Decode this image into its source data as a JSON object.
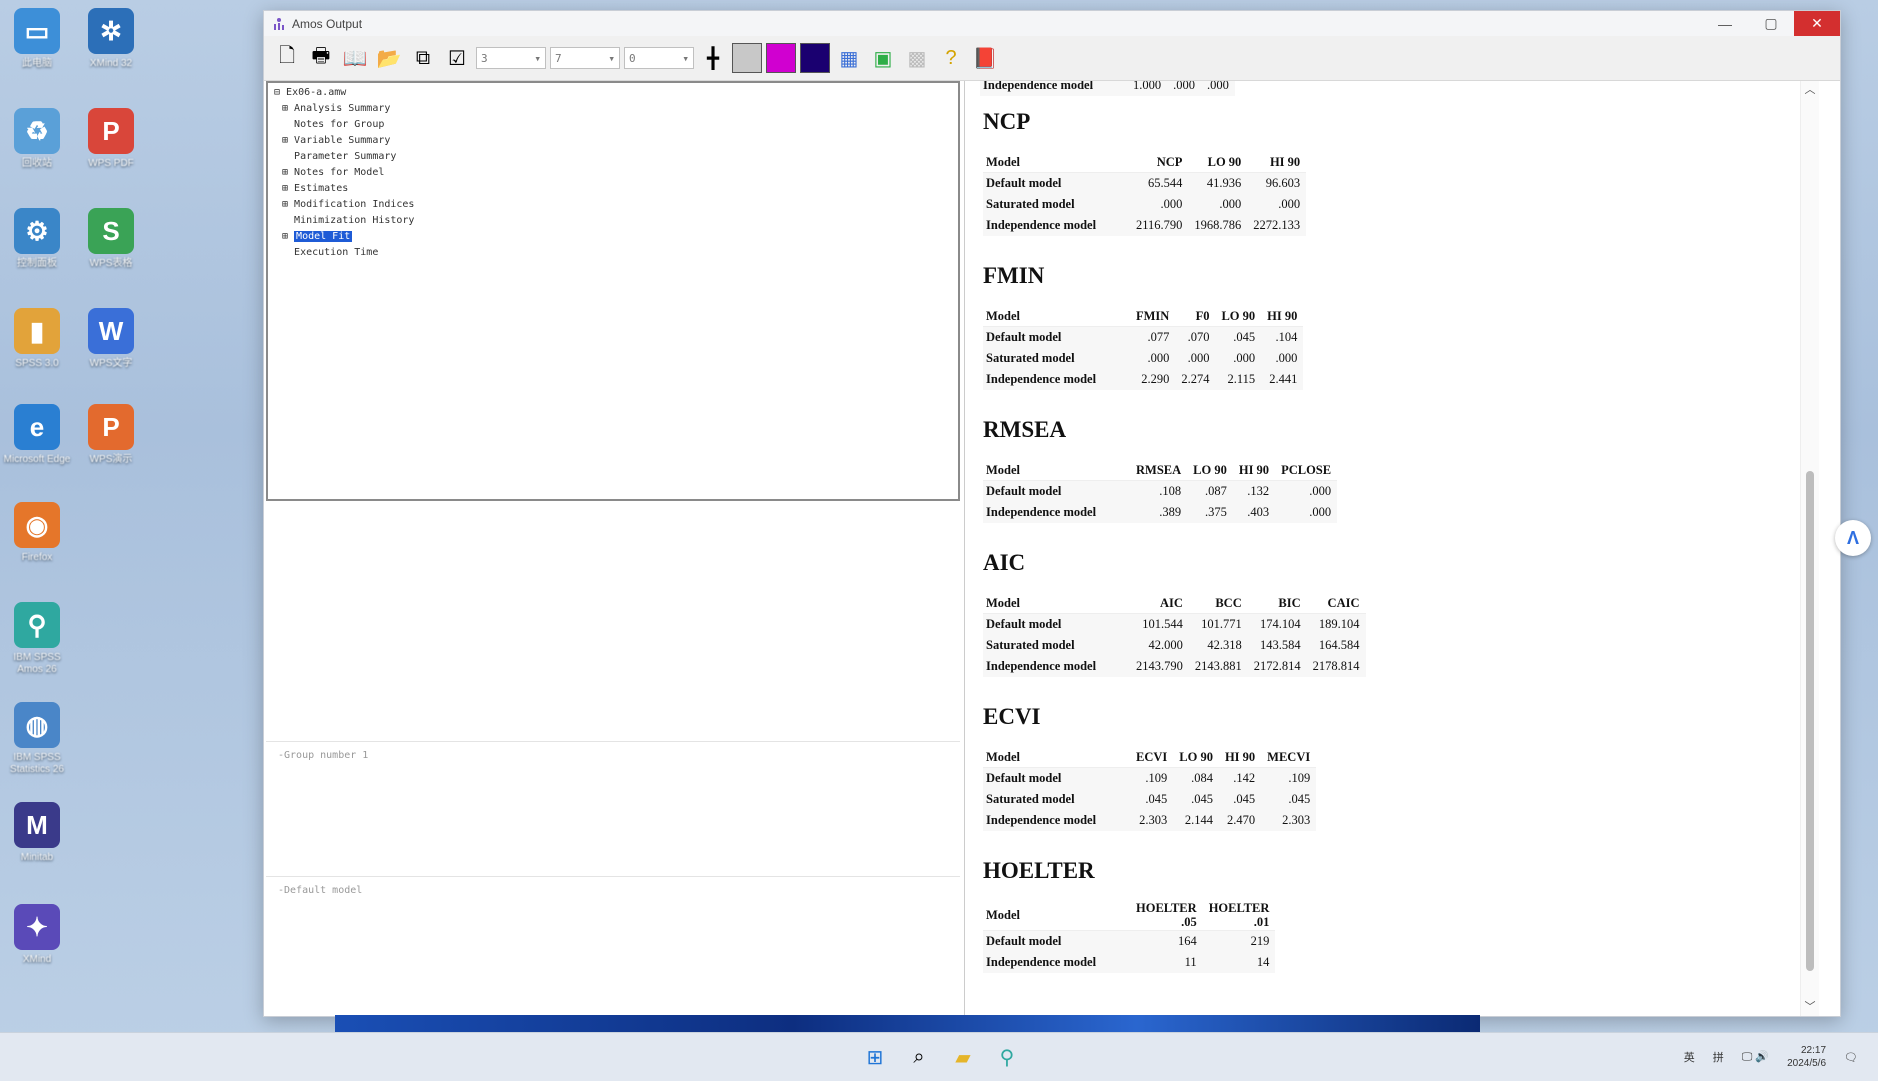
{
  "desktop": {
    "icons": [
      {
        "label": "此电脑",
        "color": "#3d8fd8",
        "glyph": "▭"
      },
      {
        "label": "XMind 32",
        "color": "#2c6fb8",
        "glyph": "✲"
      },
      {
        "label": "回收站",
        "color": "#5aa0d8",
        "glyph": "♻"
      },
      {
        "label": "WPS PDF",
        "color": "#d9463a",
        "glyph": "P"
      },
      {
        "label": "控制面板",
        "color": "#3a86c8",
        "glyph": "⚙"
      },
      {
        "label": "WPS表格",
        "color": "#3aa356",
        "glyph": "S"
      },
      {
        "label": "SPSS 3.0",
        "color": "#e2a33a",
        "glyph": "▮"
      },
      {
        "label": "WPS文字",
        "color": "#3a6fd8",
        "glyph": "W"
      },
      {
        "label": "Microsoft Edge",
        "color": "#2a7fd2",
        "glyph": "e"
      },
      {
        "label": "WPS演示",
        "color": "#e36a2e",
        "glyph": "P"
      },
      {
        "label": "Firefox",
        "color": "#e5762a",
        "glyph": "◉"
      },
      {
        "label": "IBM SPSS Amos 26",
        "color": "#2fa8a0",
        "glyph": "⚲"
      },
      {
        "label": "IBM SPSS Statistics 26",
        "color": "#4a86c8",
        "glyph": "◍"
      },
      {
        "label": "Minitab",
        "color": "#3a3a8a",
        "glyph": "M"
      },
      {
        "label": "XMind",
        "color": "#5a4ab8",
        "glyph": "✦"
      }
    ]
  },
  "window": {
    "title": "Amos Output",
    "controls": {
      "minimize": "—",
      "maximize": "▢",
      "close": "✕"
    }
  },
  "toolbar": {
    "combo1": "3",
    "combo2": "7",
    "combo3": "0",
    "colors": {
      "grid": "#c8c8c8",
      "magenta": "#d000d0",
      "navy": "#1a0070"
    }
  },
  "tree": {
    "root": "Ex06-a.amw",
    "items": [
      {
        "prefix": "⊞ ",
        "label": "Analysis Summary"
      },
      {
        "prefix": "  ",
        "label": "Notes for Group"
      },
      {
        "prefix": "⊞ ",
        "label": "Variable Summary"
      },
      {
        "prefix": "  ",
        "label": "Parameter Summary"
      },
      {
        "prefix": "⊞ ",
        "label": "Notes for Model"
      },
      {
        "prefix": "⊞ ",
        "label": "Estimates"
      },
      {
        "prefix": "⊞ ",
        "label": "Modification Indices"
      },
      {
        "prefix": "  ",
        "label": "Minimization History"
      },
      {
        "prefix": "⊞ ",
        "label": "Model Fit"
      },
      {
        "prefix": "  ",
        "label": "Execution Time"
      }
    ]
  },
  "panes": {
    "group": "-Group number 1",
    "model": "-Default model"
  },
  "output": {
    "top_stub": {
      "model": "Independence model",
      "values": [
        "1.000",
        ".000",
        ".000"
      ]
    },
    "ncp": {
      "title": "NCP",
      "headers": [
        "Model",
        "NCP",
        "LO 90",
        "HI 90"
      ],
      "rows": [
        [
          "Default model",
          "65.544",
          "41.936",
          "96.603"
        ],
        [
          "Saturated model",
          ".000",
          ".000",
          ".000"
        ],
        [
          "Independence model",
          "2116.790",
          "1968.786",
          "2272.133"
        ]
      ]
    },
    "fmin": {
      "title": "FMIN",
      "headers": [
        "Model",
        "FMIN",
        "F0",
        "LO 90",
        "HI 90"
      ],
      "rows": [
        [
          "Default model",
          ".077",
          ".070",
          ".045",
          ".104"
        ],
        [
          "Saturated model",
          ".000",
          ".000",
          ".000",
          ".000"
        ],
        [
          "Independence model",
          "2.290",
          "2.274",
          "2.115",
          "2.441"
        ]
      ]
    },
    "rmsea": {
      "title": "RMSEA",
      "headers": [
        "Model",
        "RMSEA",
        "LO 90",
        "HI 90",
        "PCLOSE"
      ],
      "rows": [
        [
          "Default model",
          ".108",
          ".087",
          ".132",
          ".000"
        ],
        [
          "Independence model",
          ".389",
          ".375",
          ".403",
          ".000"
        ]
      ]
    },
    "aic": {
      "title": "AIC",
      "headers": [
        "Model",
        "AIC",
        "BCC",
        "BIC",
        "CAIC"
      ],
      "rows": [
        [
          "Default model",
          "101.544",
          "101.771",
          "174.104",
          "189.104"
        ],
        [
          "Saturated model",
          "42.000",
          "42.318",
          "143.584",
          "164.584"
        ],
        [
          "Independence model",
          "2143.790",
          "2143.881",
          "2172.814",
          "2178.814"
        ]
      ]
    },
    "ecvi": {
      "title": "ECVI",
      "headers": [
        "Model",
        "ECVI",
        "LO 90",
        "HI 90",
        "MECVI"
      ],
      "rows": [
        [
          "Default model",
          ".109",
          ".084",
          ".142",
          ".109"
        ],
        [
          "Saturated model",
          ".045",
          ".045",
          ".045",
          ".045"
        ],
        [
          "Independence model",
          "2.303",
          "2.144",
          "2.470",
          "2.303"
        ]
      ]
    },
    "hoelter": {
      "title": "HOELTER",
      "headers": [
        "Model",
        "HOELTER\n.05",
        "HOELTER\n.01"
      ],
      "rows": [
        [
          "Default model",
          "164",
          "219"
        ],
        [
          "Independence model",
          "11",
          "14"
        ]
      ]
    }
  },
  "taskbar": {
    "tray_lang": "英",
    "tray_ime": "拼",
    "time": "22:17",
    "date": "2024/5/6"
  }
}
